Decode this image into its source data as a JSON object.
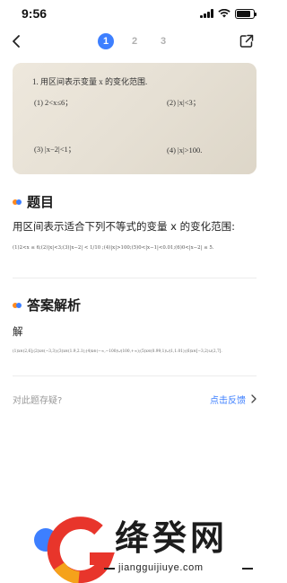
{
  "status": {
    "time": "9:56"
  },
  "nav": {
    "pages": [
      "1",
      "2",
      "3"
    ],
    "active_index": 0
  },
  "photo": {
    "heading": "1. 用区间表示变量 x 的变化范围.",
    "items": [
      "(1) 2<x≤6；",
      "(2) |x|<3；",
      "(3) |x−2|<1；",
      "(4) |x|>100."
    ]
  },
  "question": {
    "section_title": "题目",
    "text": "用区间表示适合下列不等式的变量 x 的变化范围:",
    "formula": "(1)2<x ≤ 6;(2)|x|<3;(3)|x−2| < 1/10 ;(4)|x|>100;(5)0<|x−1|<0.01;(6)0<|x−2| ≤ 5."
  },
  "answer": {
    "section_title": "答案解析",
    "label": "解",
    "formula": "(1)x∈(2,6];(2)x∈(−3,3);(3)x∈(1.9,2.1);(4)x∈(−∞,−100)∪(100,+∞);(5)x∈(0.99,1)∪(1,1.01);(6)x∈[−3,2)∪(2,7]."
  },
  "feedback": {
    "question": "对此题存疑?",
    "link": "点击反馈"
  },
  "watermark": {
    "brand": "绛癸网",
    "domain": "jiangguijiuye.com"
  },
  "colors": {
    "accent": "#3d7fff",
    "orange": "#ff8a1f"
  }
}
